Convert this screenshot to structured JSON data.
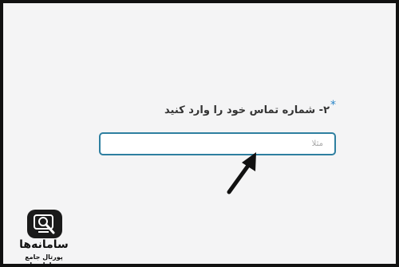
{
  "form": {
    "required_mark": "*",
    "phone_label": "۲- شماره تماس خود را وارد کنید",
    "phone_placeholder": "مثلا",
    "phone_value": ""
  },
  "logo": {
    "name": "سامانه‌ها",
    "tagline": "پورتال جامع سامانه‌ها"
  },
  "icons": {
    "pointer": "black-arrow-pointer-icon",
    "logo_icon": "magnifier-screen-logo-icon"
  },
  "colors": {
    "input_border": "#2e7fa0",
    "required_mark": "#2a86c8",
    "page_background": "#f4f4f5"
  }
}
